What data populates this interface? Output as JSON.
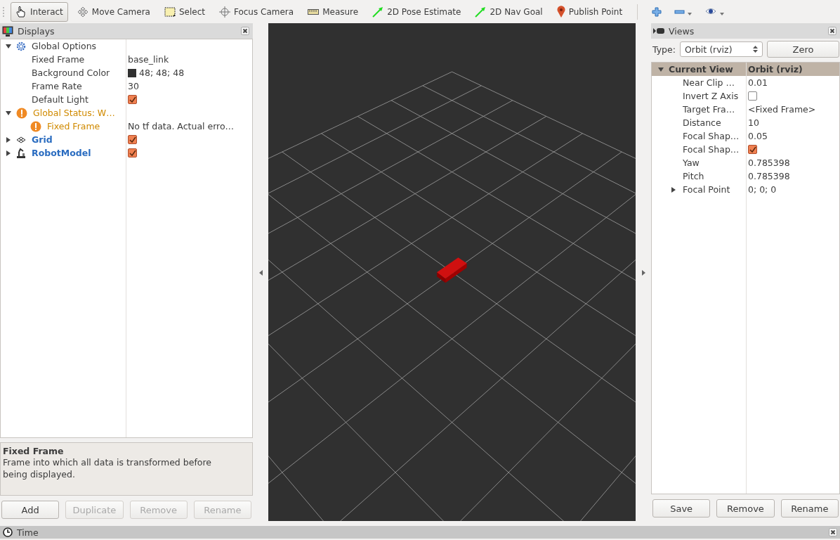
{
  "toolbar": {
    "tools": [
      {
        "kind": "interact",
        "label": "Interact",
        "selected": true
      },
      {
        "kind": "move_camera",
        "label": "Move Camera",
        "selected": false
      },
      {
        "kind": "select",
        "label": "Select",
        "selected": false
      },
      {
        "kind": "focus_camera",
        "label": "Focus Camera",
        "selected": false
      },
      {
        "kind": "measure",
        "label": "Measure",
        "selected": false
      },
      {
        "kind": "pose_estimate",
        "label": "2D Pose Estimate",
        "selected": false
      },
      {
        "kind": "nav_goal",
        "label": "2D Nav Goal",
        "selected": false
      },
      {
        "kind": "publish_point",
        "label": "Publish Point",
        "selected": false
      }
    ]
  },
  "displays": {
    "title": "Displays",
    "tree": [
      {
        "kind": "options",
        "label": "Global Options",
        "expanded": true,
        "children": [
          {
            "kind": "property",
            "label": "Fixed Frame",
            "value": "base_link"
          },
          {
            "kind": "property",
            "label": "Background Color",
            "value": "48; 48; 48",
            "color": "#303030"
          },
          {
            "kind": "property",
            "label": "Frame Rate",
            "value": "30"
          },
          {
            "kind": "property",
            "label": "Default Light",
            "checked": true
          }
        ]
      },
      {
        "kind": "warning",
        "label": "Global Status: W…",
        "expanded": true,
        "children": [
          {
            "kind": "warning",
            "label": "Fixed Frame",
            "value": "No tf data.  Actual erro…"
          }
        ]
      },
      {
        "kind": "grid",
        "label": "Grid",
        "expanded": false,
        "checked": true
      },
      {
        "kind": "robot_model",
        "label": "RobotModel",
        "expanded": false,
        "checked": true
      }
    ],
    "help": {
      "title": "Fixed Frame",
      "text": "Frame into which all data is transformed before being displayed."
    },
    "buttons": [
      {
        "label": "Add",
        "disabled": false
      },
      {
        "label": "Duplicate",
        "disabled": true
      },
      {
        "label": "Remove",
        "disabled": true
      },
      {
        "label": "Rename",
        "disabled": true
      }
    ]
  },
  "views": {
    "title": "Views",
    "type_label": "Type:",
    "type": "Orbit (rviz)",
    "zero": "Zero",
    "current": {
      "label": "Current View",
      "value": "Orbit (rviz)",
      "expanded": true,
      "children": [
        {
          "label": "Near Clip …",
          "value": "0.01"
        },
        {
          "label": "Invert Z Axis",
          "checked": false
        },
        {
          "label": "Target Fra…",
          "value": "<Fixed Frame>"
        },
        {
          "label": "Distance",
          "value": "10"
        },
        {
          "label": "Focal Shap…",
          "value": "0.05"
        },
        {
          "label": "Focal Shap…",
          "checked": true
        },
        {
          "label": "Yaw",
          "value": "0.785398"
        },
        {
          "label": "Pitch",
          "value": "0.785398"
        },
        {
          "label": "Focal Point",
          "value": "0; 0; 0",
          "expanded": false
        }
      ]
    },
    "buttons": [
      {
        "label": "Save",
        "disabled": false
      },
      {
        "label": "Remove",
        "disabled": false
      },
      {
        "label": "Rename",
        "disabled": false
      }
    ]
  },
  "time_panel": {
    "title": "Time"
  }
}
